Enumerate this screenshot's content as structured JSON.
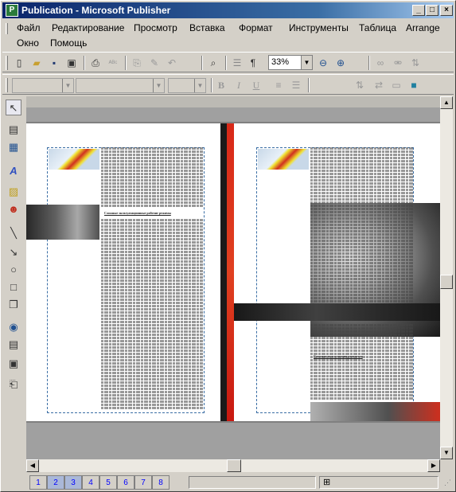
{
  "window": {
    "title": "Publication - Microsoft Publisher",
    "app_icon": "publisher-icon",
    "controls": {
      "minimize": "_",
      "maximize": "□",
      "close": "×"
    }
  },
  "menu": {
    "items": [
      "Файл",
      "Редактирование",
      "Просмотр",
      "Вставка",
      "Формат",
      "Инструменты",
      "Таблица",
      "Arrange",
      "Окно",
      "Помощь"
    ]
  },
  "toolbar": {
    "zoom_value": "33%",
    "icons": [
      "new-icon",
      "open-icon",
      "save-icon",
      "print-preview-icon",
      "print-icon",
      "spelling-icon",
      "copy-icon",
      "format-painter-icon",
      "undo-icon",
      "search-icon",
      "columns-icon",
      "paragraph-icon",
      "zoom-out-icon",
      "zoom-in-icon",
      "link-icon",
      "unlink-icon",
      "text-direction-icon"
    ]
  },
  "format_toolbar": {
    "bold": "B",
    "italic": "I",
    "underline": "U"
  },
  "left_tools": [
    "pointer-icon",
    "textbox-icon",
    "table-icon",
    "wordart-icon",
    "picture-icon",
    "clipart-icon",
    "line-icon",
    "arrow-icon",
    "oval-icon",
    "rectangle-icon",
    "autoshapes-icon",
    "hotspot-icon",
    "form-control-icon",
    "html-code-icon",
    "design-gallery-icon"
  ],
  "document": {
    "heading_left": "Сложные эксплуатационные рабочие режимы",
    "heading_right": "Сложная эксплуатация двигателя"
  },
  "status": {
    "pages": [
      "1",
      "2",
      "3",
      "4",
      "5",
      "6",
      "7",
      "8"
    ],
    "selected_pages": [
      "2",
      "3"
    ]
  }
}
